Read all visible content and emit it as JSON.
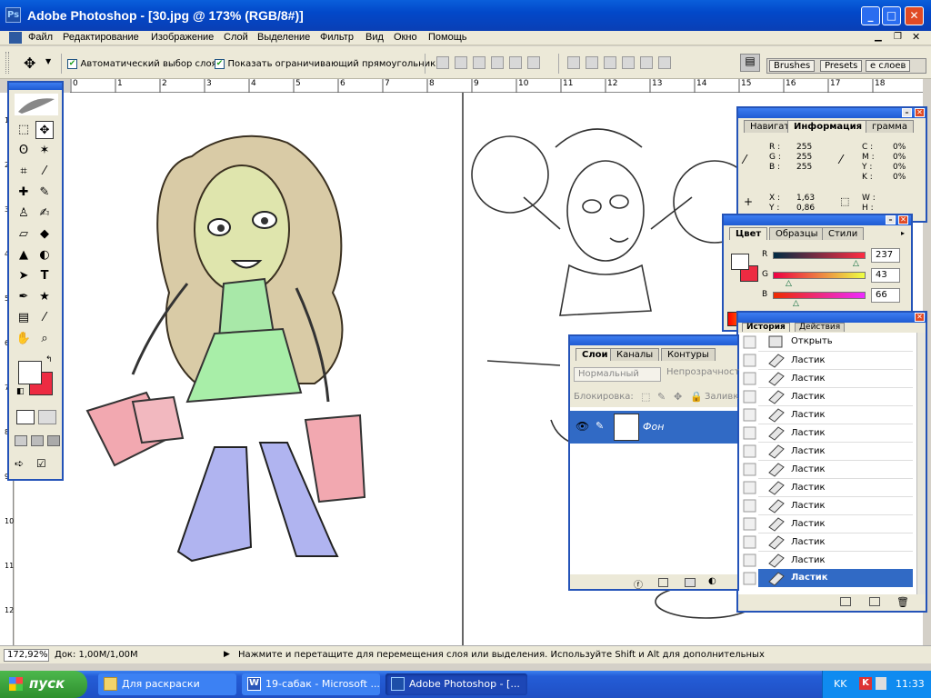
{
  "app": {
    "title": "Adobe Photoshop - [30.jpg @ 173% (RGB/8#)]"
  },
  "menu": [
    "Файл",
    "Редактирование",
    "Изображение",
    "Слой",
    "Выделение",
    "Фильтр",
    "Вид",
    "Окно",
    "Помощь"
  ],
  "options": {
    "auto_select": "Автоматический выбор слоя",
    "show_bounds": "Показать ограничивающий прямоугольник",
    "palette_tabs": [
      "Brushes",
      "Presets",
      "е слоев"
    ]
  },
  "ruler_h": [
    "0",
    "1",
    "2",
    "3",
    "4",
    "5",
    "6",
    "7",
    "8",
    "9",
    "10",
    "11",
    "12",
    "13",
    "14",
    "15",
    "16",
    "17",
    "18"
  ],
  "ruler_v": [
    "1",
    "2",
    "3",
    "4",
    "5",
    "6",
    "7",
    "8",
    "9",
    "10",
    "11",
    "12"
  ],
  "info_panel": {
    "tabs": [
      "Навигат",
      "Информация",
      "грамма"
    ],
    "r_label": "R :",
    "g_label": "G :",
    "b_label": "B :",
    "r": "255",
    "g": "255",
    "b": "255",
    "c_label": "C :",
    "m_label": "M :",
    "y_label": "Y :",
    "k_label": "K :",
    "c": "0%",
    "m": "0%",
    "y": "0%",
    "k": "0%",
    "x_label": "X :",
    "y2_label": "Y :",
    "x": "1,63",
    "y2": "0,86",
    "w_label": "W :",
    "h_label": "H :"
  },
  "color_panel": {
    "tabs": [
      "Цвет",
      "Образцы",
      "Стили"
    ],
    "r_label": "R",
    "g_label": "G",
    "b_label": "B",
    "r": "237",
    "g": "43",
    "b": "66",
    "colors": {
      "fg": "#ffffff",
      "bg": "#ed2b42"
    }
  },
  "layers_panel": {
    "tabs": [
      "Слои",
      "Каналы",
      "Контуры"
    ],
    "blend": "Нормальный",
    "opacity": "Непрозрачност",
    "lock": "Блокировка:",
    "fill": "Заливк",
    "layer_name": "Фон"
  },
  "history_panel": {
    "tabs": [
      "История",
      "Действия"
    ],
    "items": [
      "Открыть",
      "Ластик",
      "Ластик",
      "Ластик",
      "Ластик",
      "Ластик",
      "Ластик",
      "Ластик",
      "Ластик",
      "Ластик",
      "Ластик",
      "Ластик",
      "Ластик",
      "Ластик"
    ]
  },
  "status": {
    "zoom": "172,92%",
    "doc": "Док: 1,00M/1,00M",
    "hint": "Нажмите и перетащите для перемещения слоя или выделения. Используйте Shift и Alt для дополнительных"
  },
  "taskbar": {
    "start": "пуск",
    "tasks": [
      "Для раскраски",
      "19-сабак - Microsoft ...",
      "Adobe Photoshop - [..."
    ],
    "lang": "KK",
    "clock": "11:33"
  }
}
